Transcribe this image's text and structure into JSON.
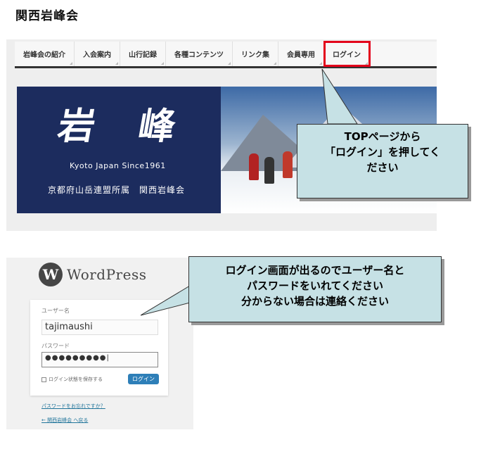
{
  "site_title": "関西岩峰会",
  "nav": {
    "items": [
      {
        "label": "岩峰会の紹介"
      },
      {
        "label": "入会案内"
      },
      {
        "label": "山行記録"
      },
      {
        "label": "各種コンテンツ"
      },
      {
        "label": "リンク集"
      },
      {
        "label": "会員専用"
      },
      {
        "label": "ログイン",
        "highlighted": true
      }
    ]
  },
  "hero": {
    "logo_kanji": "岩 峰",
    "tagline": "Kyoto Japan Since1961",
    "affiliation": "京都府山岳連盟所属　関西岩峰会"
  },
  "callout_top": {
    "lines": [
      "TOPページから",
      "「ログイン」を押してく",
      "ださい"
    ]
  },
  "wordpress": {
    "logo_text": "WordPress",
    "username_label": "ユーザー名",
    "username_value": "tajimaushi",
    "password_label": "パスワード",
    "password_mask": "●●●●●●●●●",
    "remember_label": "ログイン状態を保存する",
    "login_button": "ログイン",
    "lost_password_link": "パスワードをお忘れですか？",
    "back_link": "← 関西岩峰会 へ戻る"
  },
  "callout_login": {
    "lines": [
      "ログイン画面が出るのでユーザー名と",
      "パスワードをいれてください",
      "分からない場合は連絡ください"
    ]
  },
  "colors": {
    "highlight": "#e3001b",
    "callout_bg": "#c6e1e5",
    "hero_bg": "#1c2c5e",
    "wp_button": "#2e7fb8"
  }
}
